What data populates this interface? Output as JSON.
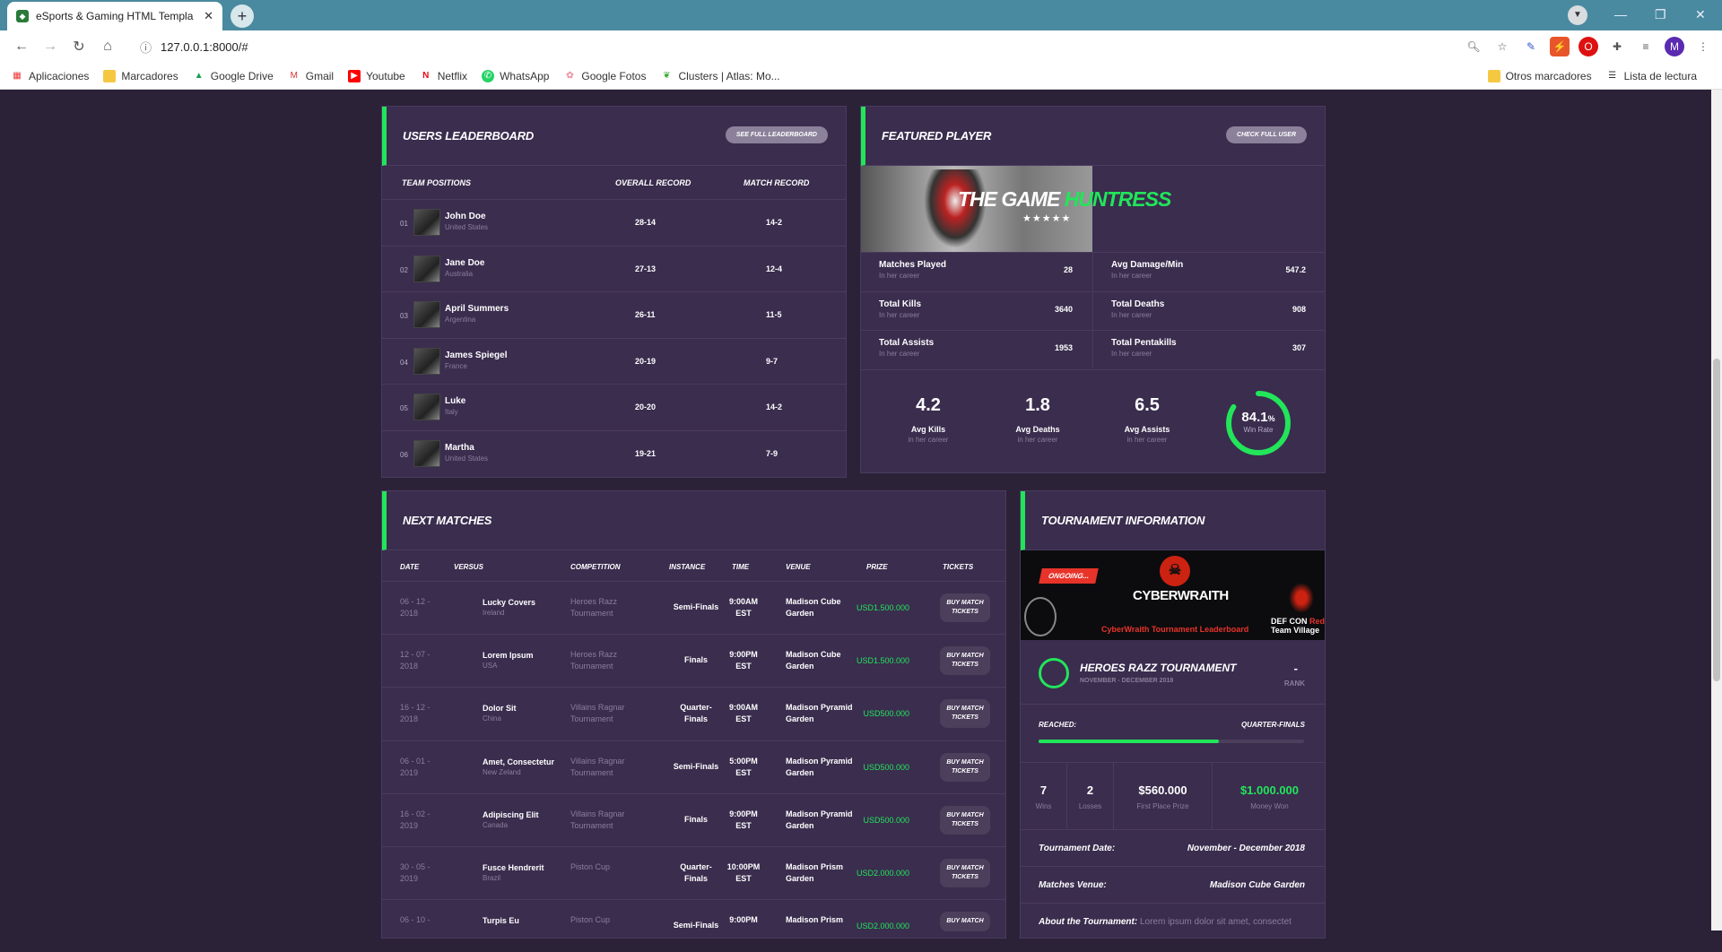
{
  "browser": {
    "tab_title": "eSports & Gaming HTML Templa",
    "url": "127.0.0.1:8000/#",
    "bookmarks": [
      "Aplicaciones",
      "Marcadores",
      "Google Drive",
      "Gmail",
      "Youtube",
      "Netflix",
      "WhatsApp",
      "Google Fotos",
      "Clusters | Atlas: Mo..."
    ],
    "bookmarks_right": [
      "Otros marcadores",
      "Lista de lectura"
    ],
    "profile": "M"
  },
  "leaderboard": {
    "title": "USERS LEADERBOARD",
    "button": "SEE FULL LEADERBOARD",
    "headers": [
      "TEAM POSITIONS",
      "OVERALL RECORD",
      "MATCH RECORD"
    ],
    "rows": [
      {
        "pos": "01",
        "name": "John Doe",
        "country": "United States",
        "overall": "28-14",
        "match": "14-2"
      },
      {
        "pos": "02",
        "name": "Jane Doe",
        "country": "Australia",
        "overall": "27-13",
        "match": "12-4"
      },
      {
        "pos": "03",
        "name": "April Summers",
        "country": "Argentina",
        "overall": "26-11",
        "match": "11-5"
      },
      {
        "pos": "04",
        "name": "James Spiegel",
        "country": "France",
        "overall": "20-19",
        "match": "9-7"
      },
      {
        "pos": "05",
        "name": "Luke",
        "country": "Italy",
        "overall": "20-20",
        "match": "14-2"
      },
      {
        "pos": "06",
        "name": "Martha",
        "country": "United States",
        "overall": "19-21",
        "match": "7-9"
      }
    ]
  },
  "featured": {
    "title": "FEATURED PLAYER",
    "button": "CHECK FULL USER",
    "banner_a": "THE GAME",
    "banner_b": "HUNTRESS",
    "stars": "★★★★★",
    "stats": [
      {
        "label": "Matches Played",
        "sub": "In her career",
        "value": "28"
      },
      {
        "label": "Avg Damage/Min",
        "sub": "In her career",
        "value": "547.2"
      },
      {
        "label": "Total Kills",
        "sub": "In her career",
        "value": "3640"
      },
      {
        "label": "Total Deaths",
        "sub": "In her career",
        "value": "908"
      },
      {
        "label": "Total Assists",
        "sub": "In her career",
        "value": "1953"
      },
      {
        "label": "Total Pentakills",
        "sub": "In her career",
        "value": "307"
      }
    ],
    "avgs": [
      {
        "value": "4.2",
        "label": "Avg Kills",
        "sub": "in her career"
      },
      {
        "value": "1.8",
        "label": "Avg Deaths",
        "sub": "in her career"
      },
      {
        "value": "6.5",
        "label": "Avg Assists",
        "sub": "in her career"
      }
    ],
    "winrate": "84.1",
    "winrate_unit": "%",
    "winrate_label": "Win Rate",
    "winrate_fraction": 0.841
  },
  "matches": {
    "title": "NEXT MATCHES",
    "headers": [
      "DATE",
      "VERSUS",
      "COMPETITION",
      "INSTANCE",
      "TIME",
      "VENUE",
      "PRIZE",
      "TICKETS"
    ],
    "rows": [
      {
        "d1": "06 - 12 -",
        "d2": "2018",
        "team": "Lucky Covers",
        "country": "Ireland",
        "c1": "Heroes Razz",
        "c2": "Tournament",
        "i1": "Semi-Finals",
        "i2": "",
        "t1": "9:00AM",
        "t2": "EST",
        "v1": "Madison Cube",
        "v2": "Garden",
        "prize": "USD1.500.000",
        "ticket": "BUY MATCH TICKETS"
      },
      {
        "d1": "12 - 07 -",
        "d2": "2018",
        "team": "Lorem Ipsum",
        "country": "USA",
        "c1": "Heroes Razz",
        "c2": "Tournament",
        "i1": "Finals",
        "i2": "",
        "t1": "9:00PM",
        "t2": "EST",
        "v1": "Madison Cube",
        "v2": "Garden",
        "prize": "USD1.500.000",
        "ticket": "BUY MATCH TICKETS"
      },
      {
        "d1": "16 - 12 -",
        "d2": "2018",
        "team": "Dolor Sit",
        "country": "China",
        "c1": "Villains Ragnar",
        "c2": "Tournament",
        "i1": "Quarter-",
        "i2": "Finals",
        "t1": "9:00AM",
        "t2": "EST",
        "v1": "Madison Pyramid",
        "v2": "Garden",
        "prize": "USD500.000",
        "ticket": "BUY MATCH TICKETS"
      },
      {
        "d1": "06 - 01 -",
        "d2": "2019",
        "team": "Amet, Consectetur",
        "country": "New Zeland",
        "c1": "Villains Ragnar",
        "c2": "Tournament",
        "i1": "Semi-Finals",
        "i2": "",
        "t1": "5:00PM",
        "t2": "EST",
        "v1": "Madison Pyramid",
        "v2": "Garden",
        "prize": "USD500.000",
        "ticket": "BUY MATCH TICKETS"
      },
      {
        "d1": "16 - 02 -",
        "d2": "2019",
        "team": "Adipiscing Elit",
        "country": "Canada",
        "c1": "Villains Ragnar",
        "c2": "Tournament",
        "i1": "Finals",
        "i2": "",
        "t1": "9:00PM",
        "t2": "EST",
        "v1": "Madison Pyramid",
        "v2": "Garden",
        "prize": "USD500.000",
        "ticket": "BUY MATCH TICKETS"
      },
      {
        "d1": "30 - 05 -",
        "d2": "2019",
        "team": "Fusce Hendrerit",
        "country": "Brazil",
        "c1": "Piston Cup",
        "c2": "",
        "i1": "Quarter-",
        "i2": "Finals",
        "t1": "10:00PM",
        "t2": "EST",
        "v1": "Madison Prism",
        "v2": "Garden",
        "prize": "USD2.000.000",
        "ticket": "BUY MATCH TICKETS"
      },
      {
        "d1": "06 - 10 -",
        "d2": "",
        "team": "Turpis Eu",
        "country": "",
        "c1": "Piston Cup",
        "c2": "",
        "i1": "Semi-Finals",
        "i2": "",
        "t1": "9:00PM",
        "t2": "",
        "v1": "Madison Prism",
        "v2": "",
        "prize": "USD2.000.000",
        "ticket": "BUY MATCH"
      }
    ]
  },
  "tournament": {
    "title": "TOURNAMENT INFORMATION",
    "badge": "ONGOING...",
    "logo": "CYBERWRAITH",
    "logo_sub": "CyberWraith Tournament Leaderboard",
    "side_a": "DEF CON",
    "side_b": "Red",
    "side_c": "Team Village",
    "name": "HEROES RAZZ TOURNAMENT",
    "dates": "NOVEMBER - DECEMBER 2018",
    "rank_value": "-",
    "rank_label": "RANK",
    "reached_label": "REACHED:",
    "reached_value": "QUARTER-FINALS",
    "progress": 0.68,
    "stats": [
      {
        "value": "7",
        "label": "Wins"
      },
      {
        "value": "2",
        "label": "Losses"
      },
      {
        "value": "$560.000",
        "label": "First Place Prize"
      },
      {
        "value": "$1.000.000",
        "label": "Money Won"
      }
    ],
    "date_label": "Tournament Date:",
    "date_value": "November - December 2018",
    "venue_label": "Matches Venue:",
    "venue_value": "Madison Cube Garden",
    "about_label": "About the Tournament:",
    "about_value": "Lorem ipsum dolor sit amet, consectet"
  }
}
